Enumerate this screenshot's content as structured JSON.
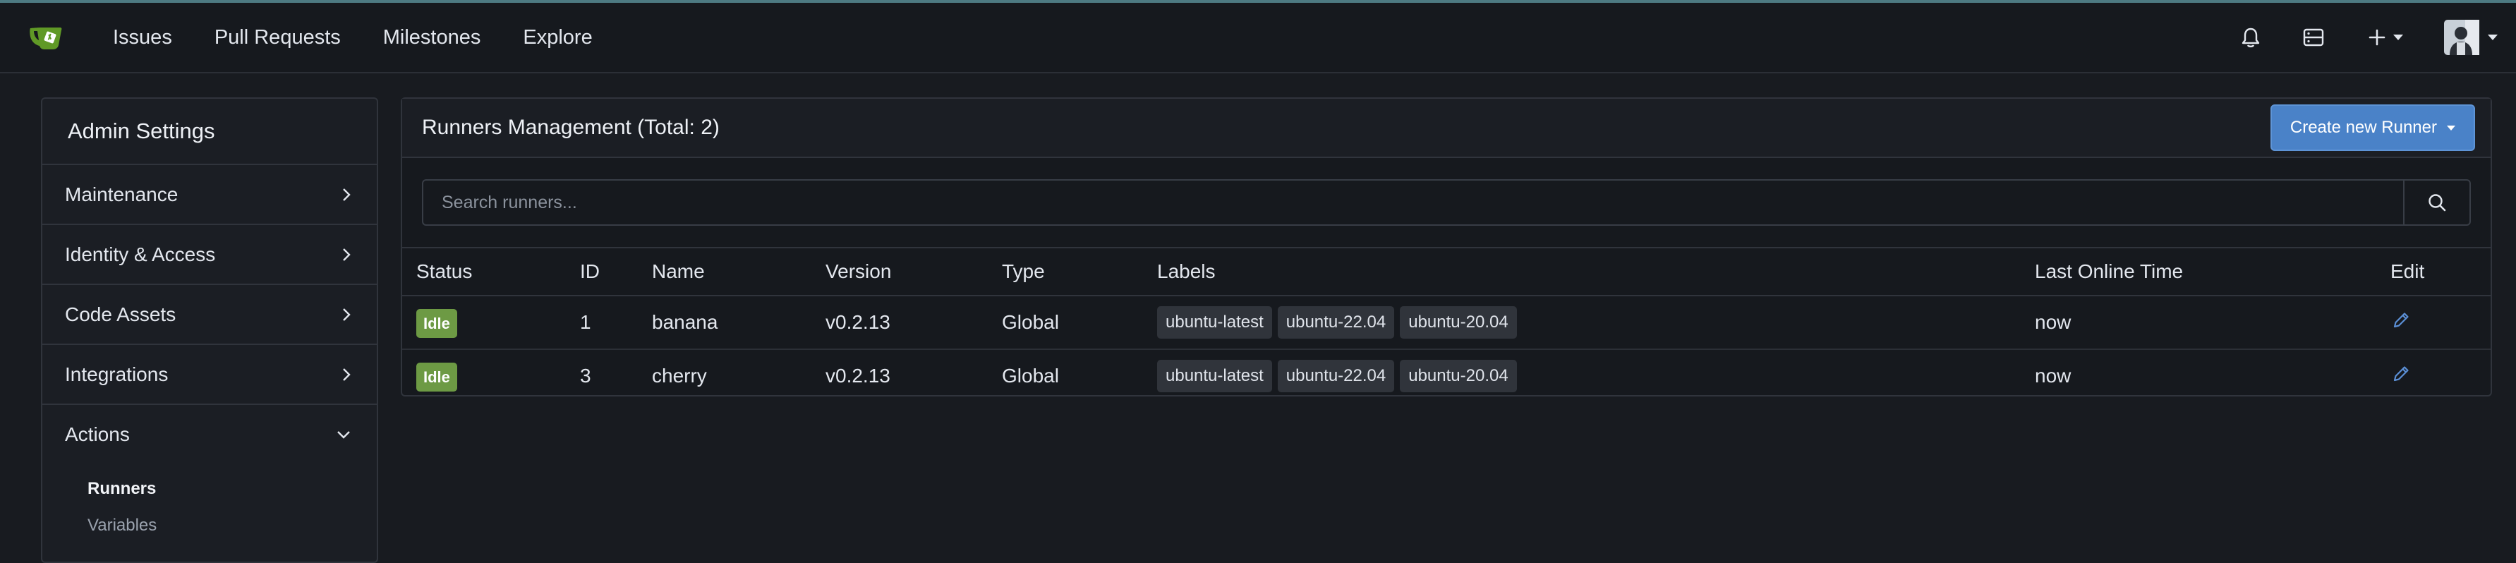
{
  "nav": {
    "links": [
      "Issues",
      "Pull Requests",
      "Milestones",
      "Explore"
    ],
    "icons": [
      "bell-icon",
      "server-icon",
      "plus-icon",
      "avatar"
    ]
  },
  "sidebar": {
    "title": "Admin Settings",
    "items": [
      {
        "label": "Maintenance"
      },
      {
        "label": "Identity & Access"
      },
      {
        "label": "Code Assets"
      },
      {
        "label": "Integrations"
      },
      {
        "label": "Actions"
      }
    ],
    "subitems": [
      {
        "label": "Runners"
      },
      {
        "label": "Variables"
      }
    ]
  },
  "main": {
    "title": "Runners Management (Total: 2)",
    "create_button": "Create new Runner",
    "search_placeholder": "Search runners...",
    "columns": [
      "Status",
      "ID",
      "Name",
      "Version",
      "Type",
      "Labels",
      "Last Online Time",
      "Edit"
    ],
    "rows": [
      {
        "status": "Idle",
        "id": "1",
        "name": "banana",
        "version": "v0.2.13",
        "type": "Global",
        "labels": [
          "ubuntu-latest",
          "ubuntu-22.04",
          "ubuntu-20.04"
        ],
        "last_online": "now"
      },
      {
        "status": "Idle",
        "id": "3",
        "name": "cherry",
        "version": "v0.2.13",
        "type": "Global",
        "labels": [
          "ubuntu-latest",
          "ubuntu-22.04",
          "ubuntu-20.04"
        ],
        "last_online": "now"
      }
    ]
  },
  "colors": {
    "accent": "#4a82c8",
    "idle_badge": "#6d9a44",
    "background": "#181b20"
  }
}
